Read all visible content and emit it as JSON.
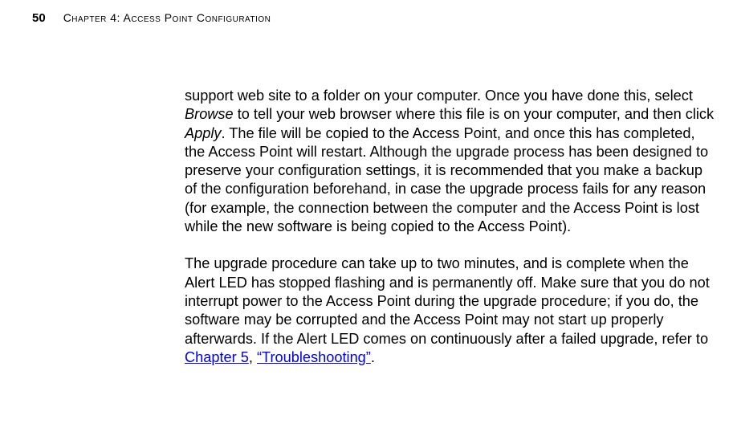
{
  "header": {
    "page_number": "50",
    "chapter_label": "Chapter 4: Access Point Configuration"
  },
  "body": {
    "p1_a": "support web site to a folder on your computer. Once you have done this, select ",
    "p1_browse": "Browse",
    "p1_b": " to tell your web browser where this file is on your computer, and then click ",
    "p1_apply": "Apply",
    "p1_c": ". The file will be copied to the Access Point, and once this has completed, the Access Point will restart. Although the upgrade process has been designed to preserve your configuration settings, it is recommended that you make a backup of the configuration beforehand, in case the upgrade process fails for any reason (for example, the connection between the computer and the Access Point is lost while the new software is being copied to the Access Point).",
    "p2_a": "The upgrade procedure can take up to two minutes, and is complete when the Alert LED has stopped flashing and is permanently off. Make sure that you do not interrupt power to the Access Point during the upgrade procedure; if you do, the software may be corrupted and the Access Point may not start up properly afterwards. If the Alert LED comes on continuously after a failed upgrade, refer to ",
    "p2_link1": "Chapter 5",
    "p2_sep": ", ",
    "p2_link2": "“Troubleshooting”",
    "p2_end": "."
  }
}
